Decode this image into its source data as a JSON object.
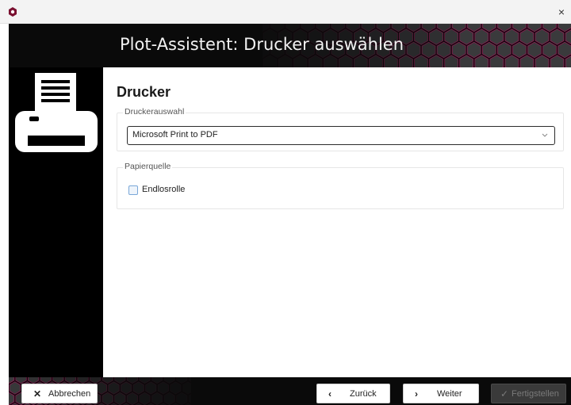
{
  "window": {
    "close_glyph": "×",
    "app_icon": "app-logo-icon"
  },
  "header": {
    "title": "Plot-Assistent: Drucker auswählen"
  },
  "sidebar": {
    "icon": "printer-icon"
  },
  "content": {
    "page_title": "Drucker",
    "printer_group": {
      "legend": "Druckerauswahl",
      "selected_printer": "Microsoft Print to PDF"
    },
    "paper_group": {
      "legend": "Papierquelle",
      "checkbox_label": "Endlosrolle",
      "checked": false
    }
  },
  "footer": {
    "cancel_label": "Abbrechen",
    "back_label": "Zurück",
    "next_label": "Weiter",
    "finish_label": "Fertigstellen",
    "finish_enabled": false
  },
  "colors": {
    "banner": "#0a0a0a",
    "hex_accent": "#c0186a",
    "checkbox_border": "#7aa7d8"
  }
}
